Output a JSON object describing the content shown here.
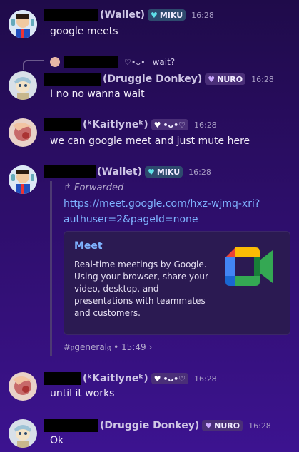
{
  "messages": [
    {
      "nick": "(Wallet)",
      "badge": "MIKU",
      "badge_icon": "cyan-heart-icon",
      "time": "16:28",
      "text": "google meets"
    },
    {
      "reply_text": "wait?",
      "nick": "(Druggie Donkey)",
      "badge": "NURO",
      "badge_icon": "purple-heart-icon",
      "time": "16:28",
      "text": "I no no wanna wait"
    },
    {
      "nick": "(𝒌𝒂𝒊𝒕𝒍𝒚𝒏𝒆)",
      "nick_display": "(ᶄKaitlyneᶄ)",
      "badge": "•ᴗ•♡",
      "badge_icon": "white-heart-icon",
      "time": "16:28",
      "text": "we can google meet and just mute here"
    },
    {
      "nick": "(Wallet)",
      "badge": "MIKU",
      "badge_icon": "cyan-heart-icon",
      "time": "16:28",
      "forwarded_label": "Forwarded",
      "link_line1": "https://meet.google.com/hxz-wjmq-xri?",
      "link_line2": "authuser=2&pageId=none",
      "embed_title": "Meet",
      "embed_desc": "Real-time meetings by Google. Using your browser, share your video, desktop, and presentations with teammates and customers.",
      "footer": "#𝔤general𝔤 • 15:49 ›"
    },
    {
      "nick": "(𝒌𝒂𝒊𝒕𝒍𝒚𝒏𝒆)",
      "nick_display": "(ᶄKaitlyneᶄ)",
      "badge": "•ᴗ•♡",
      "badge_icon": "white-heart-icon",
      "time": "16:28",
      "text": "until it works"
    },
    {
      "nick": "(Druggie Donkey)",
      "badge": "NURO",
      "badge_icon": "purple-heart-icon",
      "time": "16:28",
      "text": "Ok"
    }
  ],
  "labels": {
    "k1": "(ᴋKaitlyne)",
    "kaitlyne": "(𝒌𝒂𝒊𝒕𝒍𝒚𝒏𝒆)",
    "kaitlyne_shown": "(ᵏKaitlyneᵏ)"
  },
  "colors": {
    "link": "#7fb3ff",
    "badge_bg": "#4a2f78",
    "bg_top": "#1f0b4a",
    "bg_bottom": "#3c1390"
  }
}
